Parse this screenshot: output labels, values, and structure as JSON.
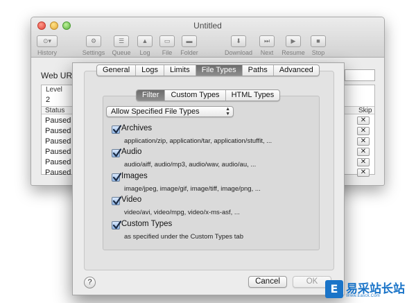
{
  "window": {
    "title": "Untitled",
    "toolbar": [
      {
        "label": "History",
        "icon": "history-icon",
        "glyph": "⊙▾"
      },
      {
        "label": "Settings",
        "icon": "gear-icon",
        "glyph": "⚙"
      },
      {
        "label": "Queue",
        "icon": "queue-icon",
        "glyph": "☰"
      },
      {
        "label": "Log",
        "icon": "warning-icon",
        "glyph": "▲"
      },
      {
        "label": "File",
        "icon": "file-icon",
        "glyph": "▭"
      },
      {
        "label": "Folder",
        "icon": "folder-icon",
        "glyph": "▬"
      },
      {
        "label": "Download",
        "icon": "download-icon",
        "glyph": "⬇"
      },
      {
        "label": "Next",
        "icon": "next-icon",
        "glyph": "⏭"
      },
      {
        "label": "Resume",
        "icon": "play-icon",
        "glyph": "▶"
      },
      {
        "label": "Stop",
        "icon": "stop-icon",
        "glyph": "■"
      }
    ],
    "web_url_label": "Web URL:",
    "level_header": "Level",
    "level_value": "2",
    "status_header": "Status",
    "skip_header": "Skip",
    "rows": [
      "Paused",
      "Paused",
      "Paused",
      "Paused",
      "Paused",
      "Paused"
    ],
    "skip_glyph": "✕"
  },
  "sheet": {
    "tabs": [
      {
        "label": "General",
        "active": false
      },
      {
        "label": "Logs",
        "active": false
      },
      {
        "label": "Limits",
        "active": false
      },
      {
        "label": "File Types",
        "active": true
      },
      {
        "label": "Paths",
        "active": false
      },
      {
        "label": "Advanced",
        "active": false
      }
    ],
    "subtabs": [
      {
        "label": "Filter",
        "active": true
      },
      {
        "label": "Custom Types",
        "active": false
      },
      {
        "label": "HTML Types",
        "active": false
      }
    ],
    "filter_popup": "Allow Specified File Types",
    "types": [
      {
        "label": "Archives",
        "checked": true,
        "description": "application/zip, application/tar, application/stuffit, ..."
      },
      {
        "label": "Audio",
        "checked": true,
        "description": "audio/aiff, audio/mp3, audio/wav, audio/au, ..."
      },
      {
        "label": "Images",
        "checked": true,
        "description": "image/jpeg, image/gif, image/tiff, image/png, ..."
      },
      {
        "label": "Video",
        "checked": true,
        "description": "video/avi, video/mpg, video/x-ms-asf, ..."
      },
      {
        "label": "Custom Types",
        "checked": true,
        "description": "as specified under the Custom Types tab"
      }
    ],
    "help_glyph": "?",
    "cancel_label": "Cancel",
    "ok_label": "OK"
  },
  "watermark": {
    "logo_glyph": "E",
    "text": "易采站长站",
    "subtext": "Www.Easck.Com"
  }
}
